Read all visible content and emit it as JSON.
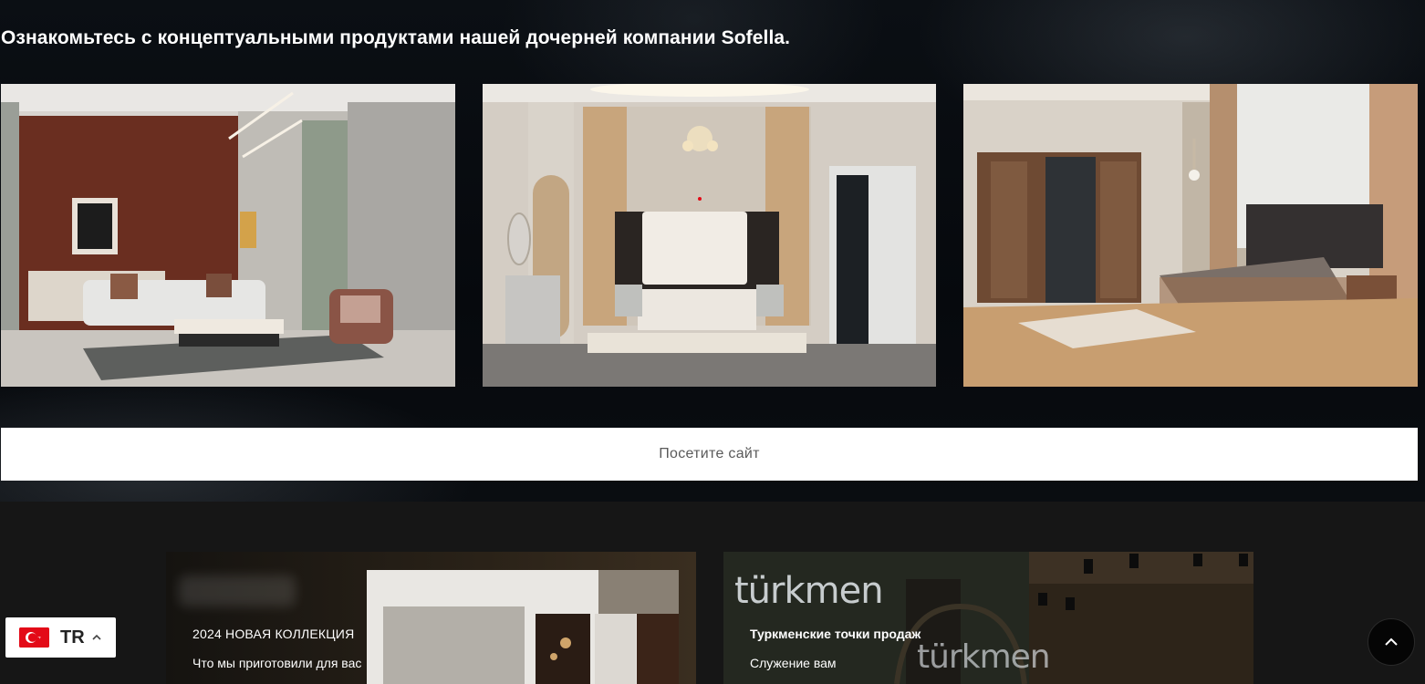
{
  "hero": {
    "title": "Ознакомьтесь с концептуальными продуктами нашей дочерней компании Sofella.",
    "products": [
      {
        "alt": "living room set"
      },
      {
        "alt": "bedroom set"
      },
      {
        "alt": "bedroom wardrobe set"
      }
    ],
    "visit_button": "Посетите сайт"
  },
  "cards": [
    {
      "title": "2024 НОВАЯ КОЛЛЕКЦИЯ",
      "subtitle": "Что мы приготовили для вас"
    },
    {
      "title": "Туркменские точки продаж",
      "subtitle": "Служение вам",
      "brand_sign": "türkmen"
    }
  ],
  "language": {
    "code": "TR",
    "flag_color": "#e30a17"
  },
  "colors": {
    "accent_red": "#e30a17",
    "background": "#161616"
  }
}
